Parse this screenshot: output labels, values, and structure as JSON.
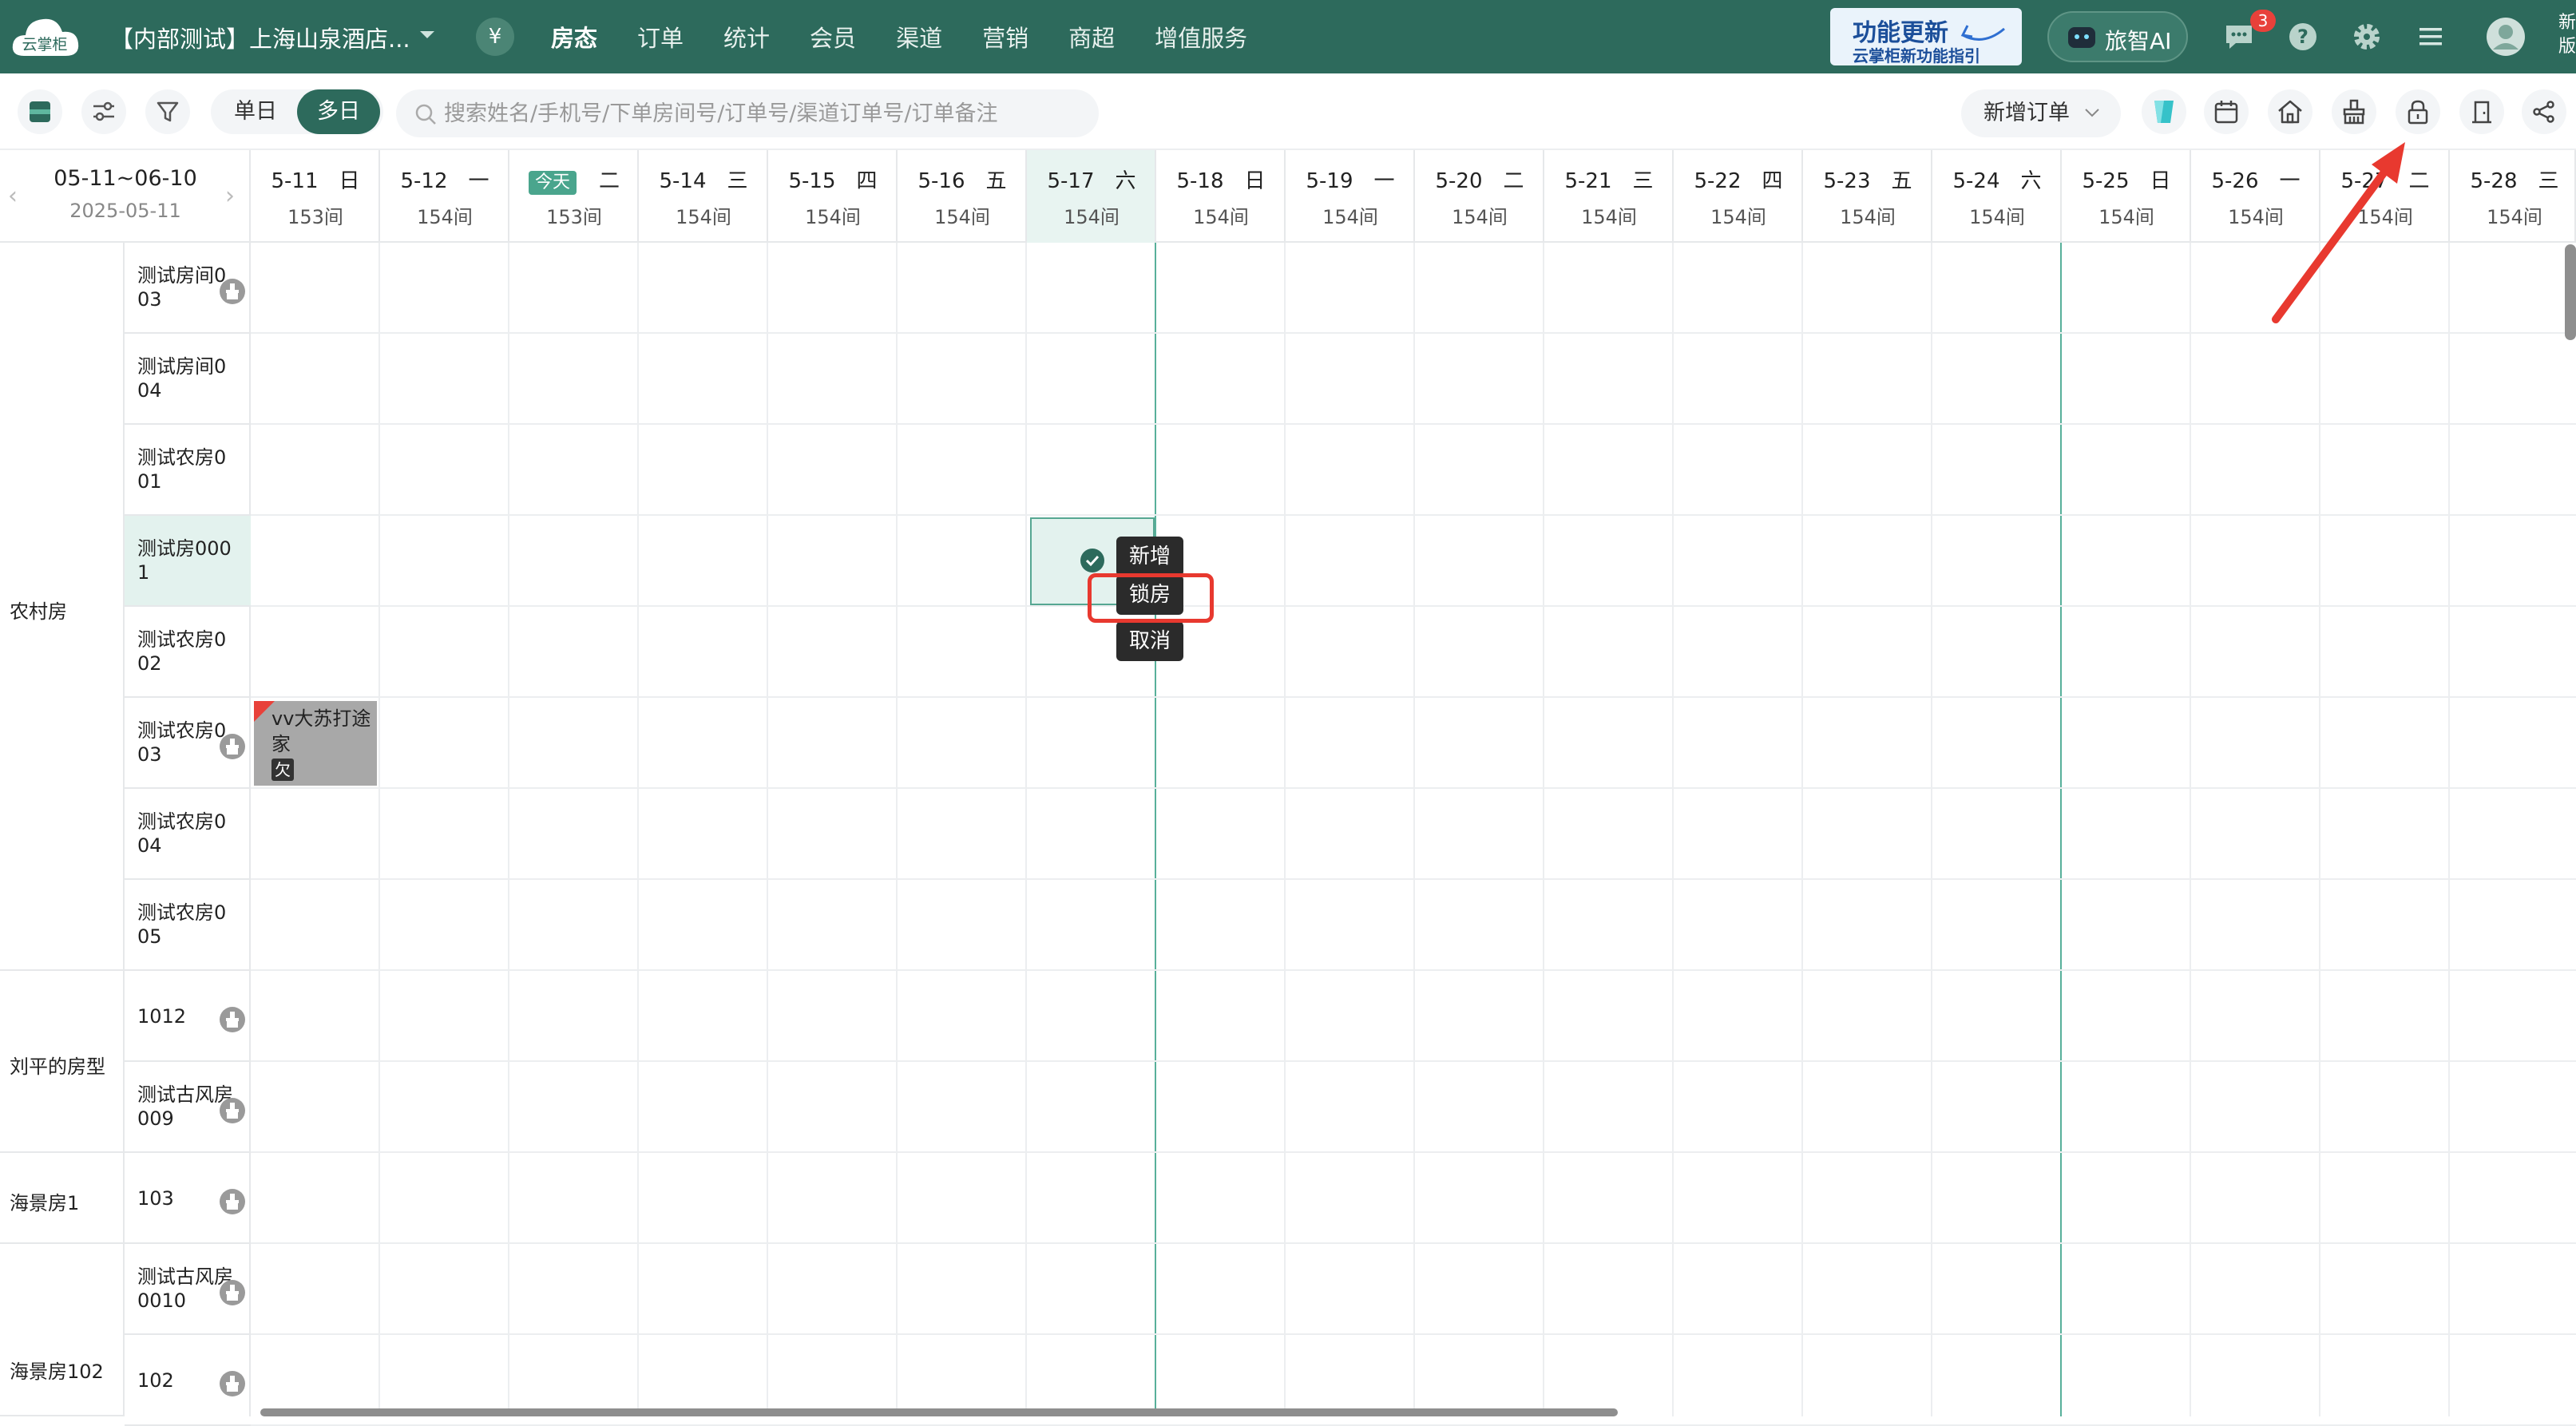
{
  "topbar": {
    "logo_text": "云掌柜",
    "hotel_name": "【内部测试】上海山泉酒店...",
    "currency_symbol": "¥",
    "nav": [
      "房态",
      "订单",
      "统计",
      "会员",
      "渠道",
      "营销",
      "商超",
      "增值服务"
    ],
    "promo_line1": "功能更新",
    "promo_line2": "云掌柜新功能指引",
    "ai_label": "旅智AI",
    "message_count": "3",
    "edge_text": "新版"
  },
  "toolbar": {
    "view_single": "单日",
    "view_multi": "多日",
    "search_placeholder": "搜索姓名/手机号/下单房间号/订单号/渠道订单号/订单备注",
    "new_order": "新增订单"
  },
  "date_header": {
    "range": "05-11~06-10",
    "current_date": "2025-05-11",
    "today_label": "今天",
    "days": [
      {
        "date": "5-11",
        "weekday": "日",
        "count": "153间"
      },
      {
        "date": "5-12",
        "weekday": "一",
        "count": "154间"
      },
      {
        "date": "",
        "weekday": "二",
        "count": "153间",
        "today": true
      },
      {
        "date": "5-14",
        "weekday": "三",
        "count": "154间"
      },
      {
        "date": "5-15",
        "weekday": "四",
        "count": "154间"
      },
      {
        "date": "5-16",
        "weekday": "五",
        "count": "154间"
      },
      {
        "date": "5-17",
        "weekday": "六",
        "count": "154间",
        "selected": true
      },
      {
        "date": "5-18",
        "weekday": "日",
        "count": "154间"
      },
      {
        "date": "5-19",
        "weekday": "一",
        "count": "154间"
      },
      {
        "date": "5-20",
        "weekday": "二",
        "count": "154间"
      },
      {
        "date": "5-21",
        "weekday": "三",
        "count": "154间"
      },
      {
        "date": "5-22",
        "weekday": "四",
        "count": "154间"
      },
      {
        "date": "5-23",
        "weekday": "五",
        "count": "154间"
      },
      {
        "date": "5-24",
        "weekday": "六",
        "count": "154间"
      },
      {
        "date": "5-25",
        "weekday": "日",
        "count": "154间"
      },
      {
        "date": "5-26",
        "weekday": "一",
        "count": "154间"
      },
      {
        "date": "5-27",
        "weekday": "二",
        "count": "154间"
      },
      {
        "date": "5-28",
        "weekday": "三",
        "count": "154间"
      }
    ]
  },
  "room_types": [
    {
      "name": "农村房",
      "rooms": 8
    },
    {
      "name": "刘平的房型",
      "rooms": 2
    },
    {
      "name": "海景房1",
      "rooms": 1
    },
    {
      "name": "海景房102",
      "rooms": 2
    }
  ],
  "rooms": [
    {
      "name": "测试房间003",
      "clean_icon": true
    },
    {
      "name": "测试房间004",
      "clean_icon": false
    },
    {
      "name": "测试农房001",
      "clean_icon": false
    },
    {
      "name": "测试房0001",
      "clean_icon": false,
      "selected": true
    },
    {
      "name": "测试农房002",
      "clean_icon": false
    },
    {
      "name": "测试农房003",
      "clean_icon": true
    },
    {
      "name": "测试农房004",
      "clean_icon": false
    },
    {
      "name": "测试农房005",
      "clean_icon": false
    },
    {
      "name": "1012",
      "clean_icon": true
    },
    {
      "name": "测试古风房009",
      "clean_icon": true
    },
    {
      "name": "103",
      "clean_icon": true
    },
    {
      "name": "测试古风房0010",
      "clean_icon": true
    },
    {
      "name": "102",
      "clean_icon": true
    }
  ],
  "booking": {
    "guest": "vv大苏打途家",
    "tag": "欠"
  },
  "context_menu": [
    "新增",
    "锁房",
    "取消"
  ],
  "colors": {
    "brand": "#2d6a5c",
    "highlight": "#e8392f",
    "today_line": "#58b09a"
  }
}
